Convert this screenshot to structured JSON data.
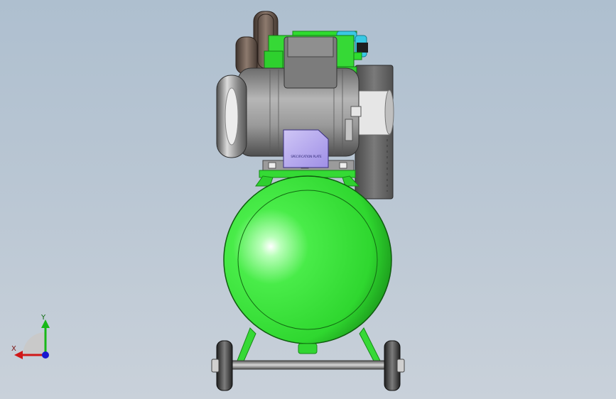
{
  "viewport": {
    "background_top": "#aebfcf",
    "background_bottom": "#c9d1da"
  },
  "model": {
    "name_plate_text": "SPECIFICATION PLATE",
    "colors": {
      "tank": "#39e339",
      "tank_dark": "#1f8f1f",
      "frame": "#2fcf2f",
      "motor": "#9a9a9a",
      "motor_dark": "#5e5e5e",
      "name_plate": "#b7a8ee",
      "fitting": "#33c9e0",
      "pulley": "#6e5a50",
      "guard": "#6a6a6a",
      "wheel": "#333333"
    }
  },
  "triad": {
    "x_label": "X",
    "y_label": "Y",
    "x_color": "#d01818",
    "y_color": "#18b818",
    "z_color": "#1818d0"
  }
}
